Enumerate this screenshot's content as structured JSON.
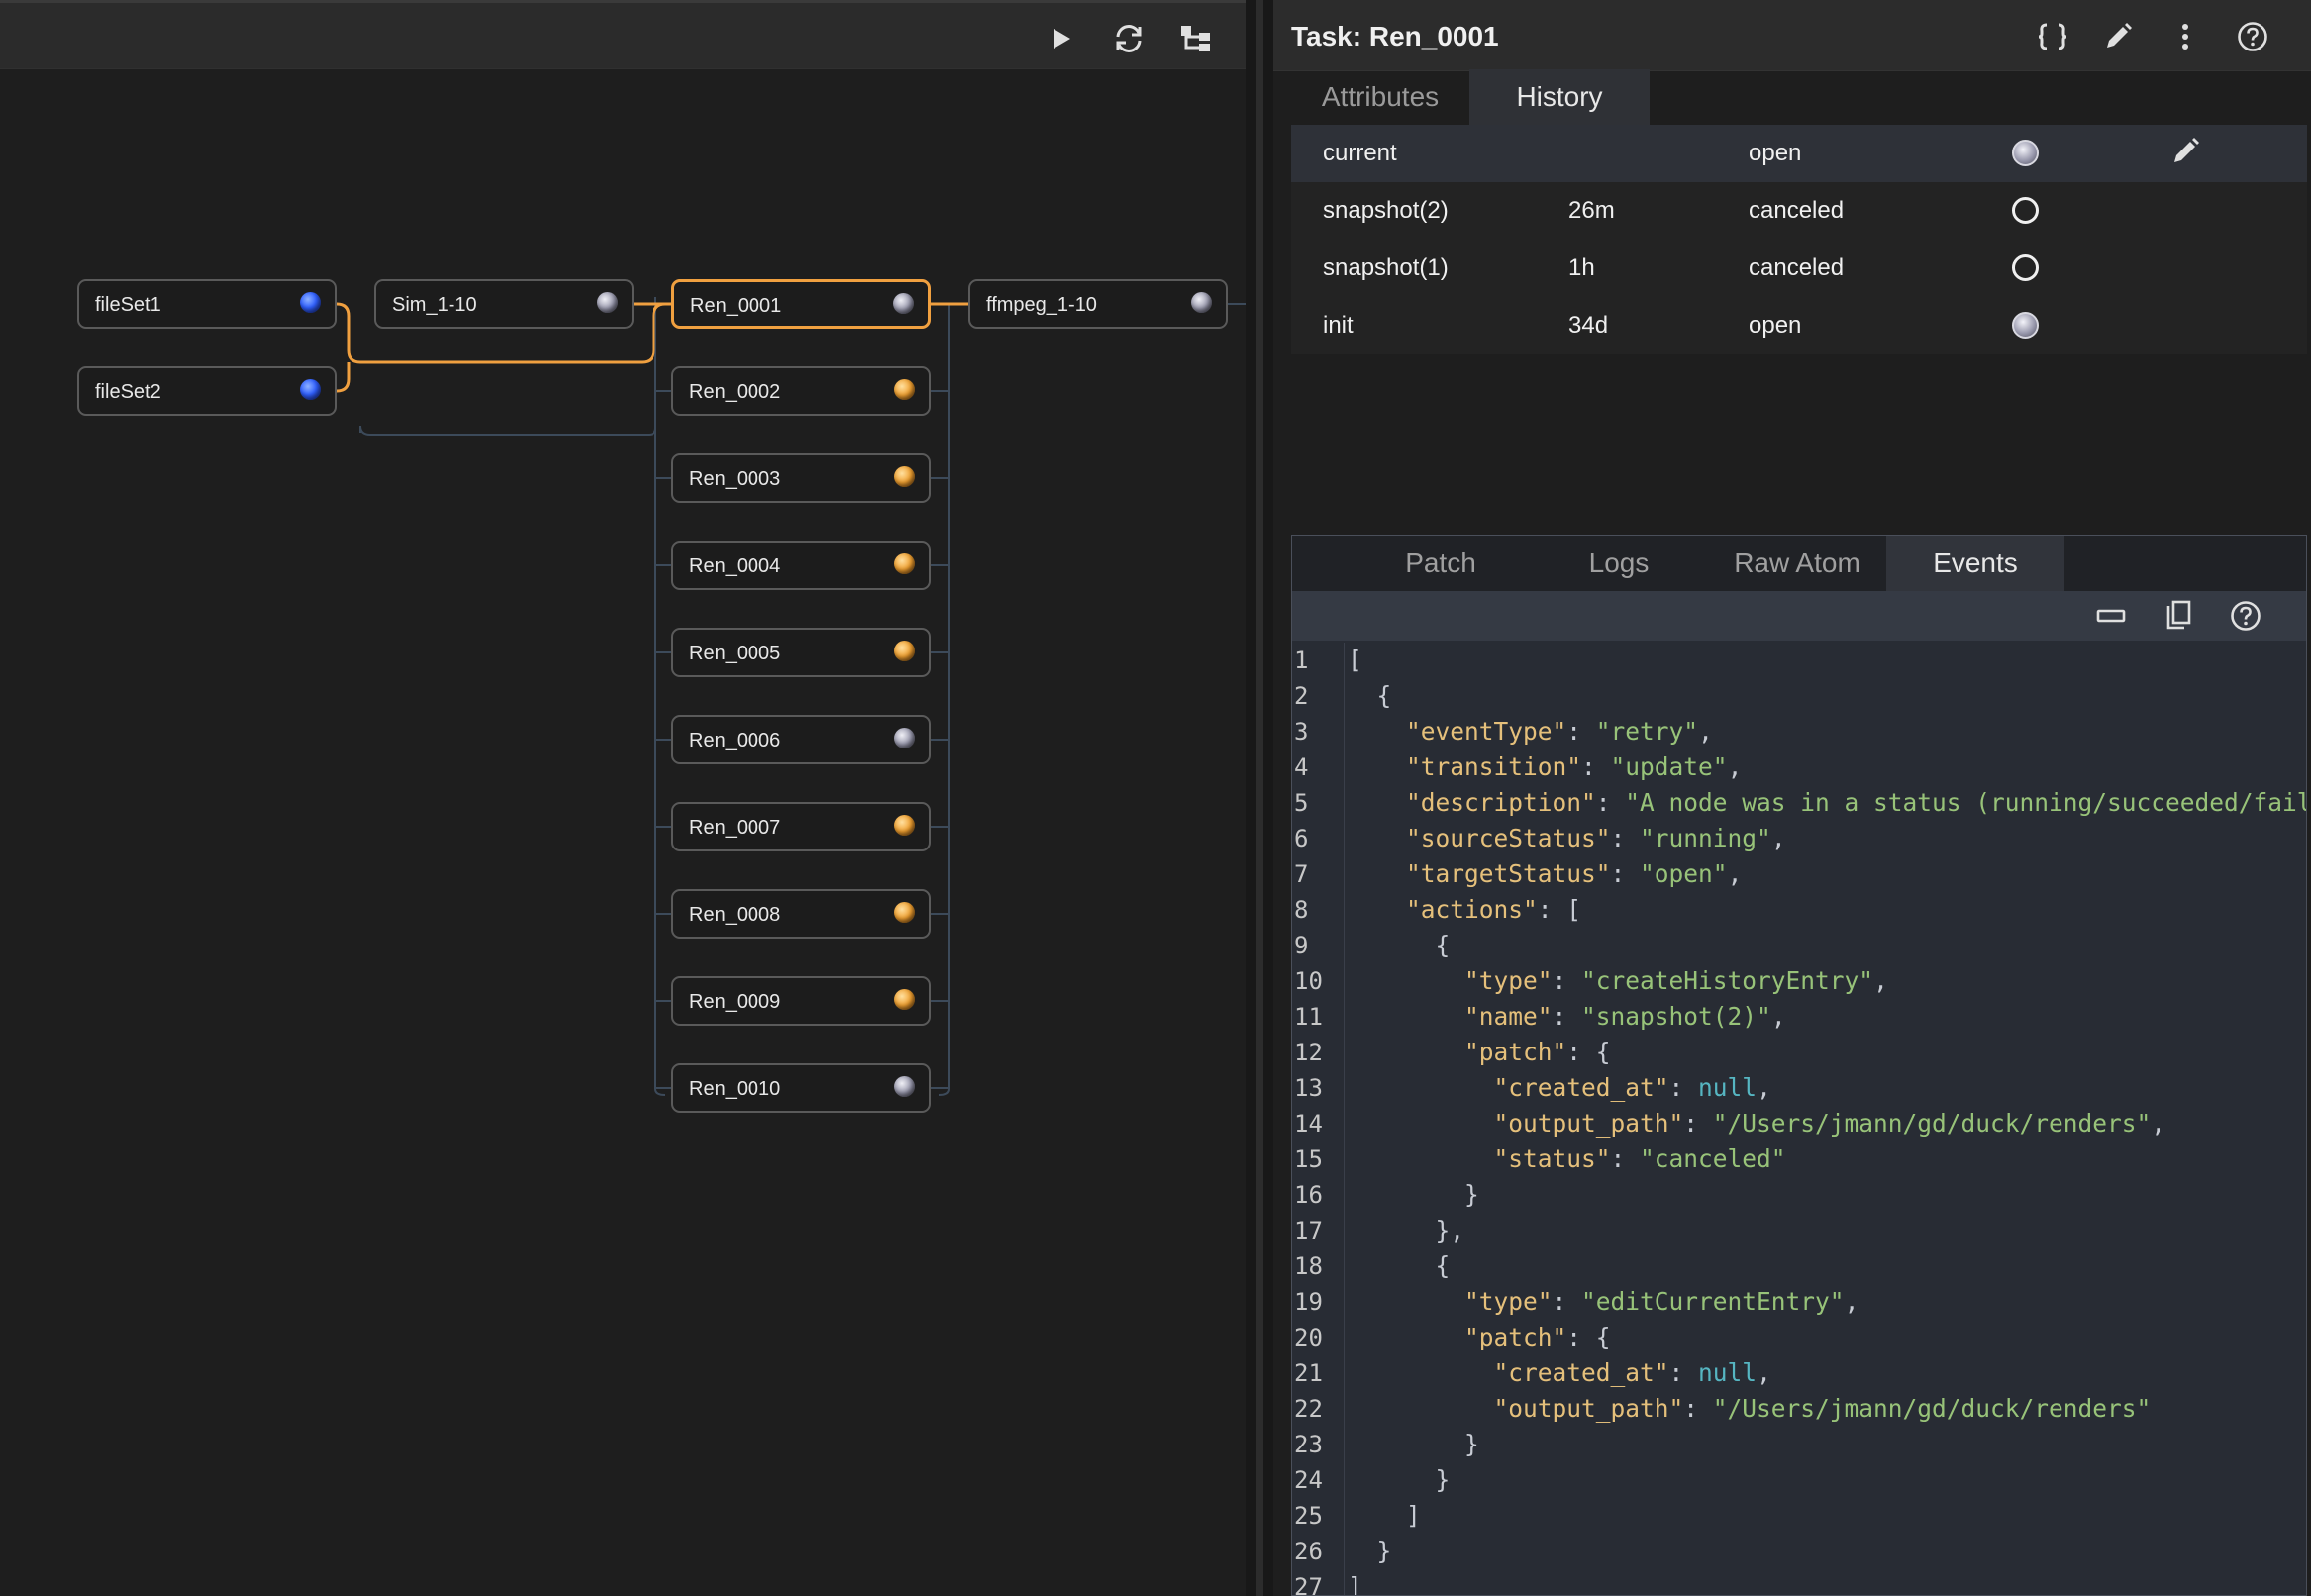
{
  "graph": {
    "toolbar": {
      "play_icon": "play-icon",
      "refresh_icon": "refresh-icon",
      "layout_icon": "tree-layout-icon"
    },
    "nodes": [
      {
        "label": "fileSet1",
        "status": "blue"
      },
      {
        "label": "fileSet2",
        "status": "blue"
      },
      {
        "label": "Sim_1-10",
        "status": "gray"
      },
      {
        "label": "Ren_0001",
        "status": "gray",
        "selected": true
      },
      {
        "label": "Ren_0002",
        "status": "orange"
      },
      {
        "label": "Ren_0003",
        "status": "orange"
      },
      {
        "label": "Ren_0004",
        "status": "orange"
      },
      {
        "label": "Ren_0005",
        "status": "orange"
      },
      {
        "label": "Ren_0006",
        "status": "gray"
      },
      {
        "label": "Ren_0007",
        "status": "orange"
      },
      {
        "label": "Ren_0008",
        "status": "orange"
      },
      {
        "label": "Ren_0009",
        "status": "orange"
      },
      {
        "label": "Ren_0010",
        "status": "gray"
      },
      {
        "label": "ffmpeg_1-10",
        "status": "gray"
      }
    ],
    "colors": {
      "selected_edge": "#f0a040",
      "edge": "#3c4a5a",
      "blue": "#3060ff",
      "orange": "#f0a030",
      "gray": "#9a9aae"
    }
  },
  "task": {
    "title": "Task: Ren_0001",
    "header_icons": [
      "braces-icon",
      "pencil-icon",
      "more-vertical-icon",
      "help-icon"
    ],
    "tabs": [
      {
        "label": "Attributes"
      },
      {
        "label": "History",
        "active": true
      }
    ],
    "history": [
      {
        "name": "current",
        "age": "",
        "status": "open",
        "state": "filled",
        "editable": true
      },
      {
        "name": "snapshot(2)",
        "age": "26m",
        "status": "canceled",
        "state": "empty"
      },
      {
        "name": "snapshot(1)",
        "age": "1h",
        "status": "canceled",
        "state": "empty"
      },
      {
        "name": "init",
        "age": "34d",
        "status": "open",
        "state": "filled"
      }
    ]
  },
  "code_viewer": {
    "tabs": [
      {
        "label": "Patch"
      },
      {
        "label": "Logs"
      },
      {
        "label": "Raw Atom"
      },
      {
        "label": "Events",
        "active": true
      }
    ],
    "toolbar_icons": [
      "collapse-icon",
      "copy-icon",
      "help-icon"
    ],
    "lines": [
      "1",
      "2",
      "3",
      "4",
      "5",
      "6",
      "7",
      "8",
      "9",
      "10",
      "11",
      "12",
      "13",
      "14",
      "15",
      "16",
      "17",
      "18",
      "19",
      "20",
      "21",
      "22",
      "23",
      "24",
      "25",
      "26",
      "27"
    ],
    "code": [
      [
        {
          "t": "p",
          "v": "["
        }
      ],
      [
        {
          "t": "p",
          "v": "  {"
        }
      ],
      [
        {
          "t": "p",
          "v": "    "
        },
        {
          "t": "k",
          "v": "\"eventType\""
        },
        {
          "t": "p",
          "v": ": "
        },
        {
          "t": "s",
          "v": "\"retry\""
        },
        {
          "t": "p",
          "v": ","
        }
      ],
      [
        {
          "t": "p",
          "v": "    "
        },
        {
          "t": "k",
          "v": "\"transition\""
        },
        {
          "t": "p",
          "v": ": "
        },
        {
          "t": "s",
          "v": "\"update\""
        },
        {
          "t": "p",
          "v": ","
        }
      ],
      [
        {
          "t": "p",
          "v": "    "
        },
        {
          "t": "k",
          "v": "\"description\""
        },
        {
          "t": "p",
          "v": ": "
        },
        {
          "t": "s",
          "v": "\"A node was in a status (running/succeeded/fail"
        }
      ],
      [
        {
          "t": "p",
          "v": "    "
        },
        {
          "t": "k",
          "v": "\"sourceStatus\""
        },
        {
          "t": "p",
          "v": ": "
        },
        {
          "t": "s",
          "v": "\"running\""
        },
        {
          "t": "p",
          "v": ","
        }
      ],
      [
        {
          "t": "p",
          "v": "    "
        },
        {
          "t": "k",
          "v": "\"targetStatus\""
        },
        {
          "t": "p",
          "v": ": "
        },
        {
          "t": "s",
          "v": "\"open\""
        },
        {
          "t": "p",
          "v": ","
        }
      ],
      [
        {
          "t": "p",
          "v": "    "
        },
        {
          "t": "k",
          "v": "\"actions\""
        },
        {
          "t": "p",
          "v": ": ["
        }
      ],
      [
        {
          "t": "p",
          "v": "      {"
        }
      ],
      [
        {
          "t": "p",
          "v": "        "
        },
        {
          "t": "k",
          "v": "\"type\""
        },
        {
          "t": "p",
          "v": ": "
        },
        {
          "t": "s",
          "v": "\"createHistoryEntry\""
        },
        {
          "t": "p",
          "v": ","
        }
      ],
      [
        {
          "t": "p",
          "v": "        "
        },
        {
          "t": "k",
          "v": "\"name\""
        },
        {
          "t": "p",
          "v": ": "
        },
        {
          "t": "s",
          "v": "\"snapshot(2)\""
        },
        {
          "t": "p",
          "v": ","
        }
      ],
      [
        {
          "t": "p",
          "v": "        "
        },
        {
          "t": "k",
          "v": "\"patch\""
        },
        {
          "t": "p",
          "v": ": {"
        }
      ],
      [
        {
          "t": "p",
          "v": "          "
        },
        {
          "t": "k",
          "v": "\"created_at\""
        },
        {
          "t": "p",
          "v": ": "
        },
        {
          "t": "n",
          "v": "null"
        },
        {
          "t": "p",
          "v": ","
        }
      ],
      [
        {
          "t": "p",
          "v": "          "
        },
        {
          "t": "k",
          "v": "\"output_path\""
        },
        {
          "t": "p",
          "v": ": "
        },
        {
          "t": "s",
          "v": "\"/Users/jmann/gd/duck/renders\""
        },
        {
          "t": "p",
          "v": ","
        }
      ],
      [
        {
          "t": "p",
          "v": "          "
        },
        {
          "t": "k",
          "v": "\"status\""
        },
        {
          "t": "p",
          "v": ": "
        },
        {
          "t": "s",
          "v": "\"canceled\""
        }
      ],
      [
        {
          "t": "p",
          "v": "        }"
        }
      ],
      [
        {
          "t": "p",
          "v": "      },"
        }
      ],
      [
        {
          "t": "p",
          "v": "      {"
        }
      ],
      [
        {
          "t": "p",
          "v": "        "
        },
        {
          "t": "k",
          "v": "\"type\""
        },
        {
          "t": "p",
          "v": ": "
        },
        {
          "t": "s",
          "v": "\"editCurrentEntry\""
        },
        {
          "t": "p",
          "v": ","
        }
      ],
      [
        {
          "t": "p",
          "v": "        "
        },
        {
          "t": "k",
          "v": "\"patch\""
        },
        {
          "t": "p",
          "v": ": {"
        }
      ],
      [
        {
          "t": "p",
          "v": "          "
        },
        {
          "t": "k",
          "v": "\"created_at\""
        },
        {
          "t": "p",
          "v": ": "
        },
        {
          "t": "n",
          "v": "null"
        },
        {
          "t": "p",
          "v": ","
        }
      ],
      [
        {
          "t": "p",
          "v": "          "
        },
        {
          "t": "k",
          "v": "\"output_path\""
        },
        {
          "t": "p",
          "v": ": "
        },
        {
          "t": "s",
          "v": "\"/Users/jmann/gd/duck/renders\""
        }
      ],
      [
        {
          "t": "p",
          "v": "        }"
        }
      ],
      [
        {
          "t": "p",
          "v": "      }"
        }
      ],
      [
        {
          "t": "p",
          "v": "    ]"
        }
      ],
      [
        {
          "t": "p",
          "v": "  }"
        }
      ],
      [
        {
          "t": "p",
          "v": "]"
        }
      ]
    ]
  }
}
